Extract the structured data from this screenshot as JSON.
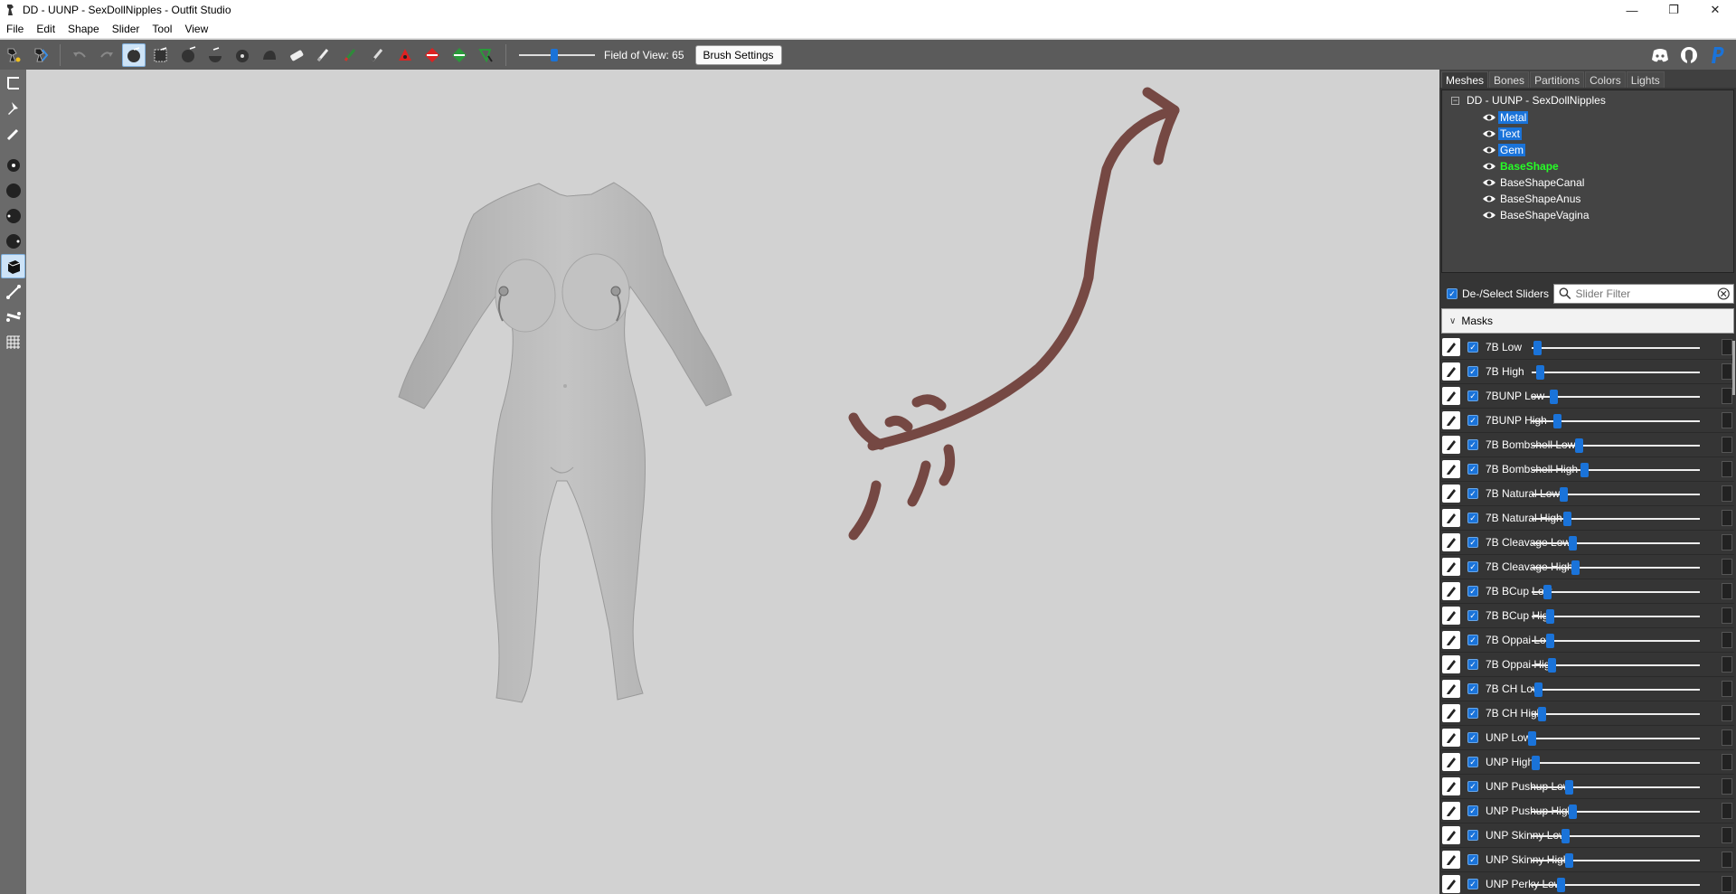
{
  "window": {
    "title": "DD - UUNP - SexDollNipples - Outfit Studio",
    "controls": [
      "minimize",
      "maximize",
      "close"
    ]
  },
  "menu": [
    "File",
    "Edit",
    "Shape",
    "Slider",
    "Tool",
    "View"
  ],
  "toolbar": {
    "field_of_view_label": "Field of View: 65",
    "fov_value": 65,
    "brush_settings_label": "Brush Settings",
    "icons": [
      "select-icon",
      "transform-icon",
      "undo-icon",
      "redo-icon",
      "standard-brush-icon",
      "mask-brush-icon",
      "inflate-brush-icon",
      "deflate-brush-icon",
      "move-brush-icon",
      "smooth-brush-icon",
      "undiff-brush-icon",
      "color-brush-icon",
      "alpha-brush-icon",
      "weight-brush-icon",
      "marker-icon",
      "collapse-icon",
      "flip-icon",
      "edit-vertex-icon"
    ],
    "right_icons": [
      "discord-icon",
      "github-icon",
      "paypal-icon"
    ]
  },
  "left_tools": [
    "transform-icon",
    "pivot-icon",
    "pen-icon",
    "brush-small-icon",
    "brush-medium-icon",
    "brush-large-icon",
    "brush-xlarge-icon",
    "select-box-icon",
    "bone-icon",
    "vertex-icon",
    "grid-icon"
  ],
  "tabs": [
    "Meshes",
    "Bones",
    "Partitions",
    "Colors",
    "Lights"
  ],
  "active_tab": "Meshes",
  "mesh_tree": {
    "root": "DD - UUNP - SexDollNipples",
    "items": [
      {
        "label": "Metal",
        "state": "selected"
      },
      {
        "label": "Text",
        "state": "selected"
      },
      {
        "label": "Gem",
        "state": "selected"
      },
      {
        "label": "BaseShape",
        "state": "reference"
      },
      {
        "label": "BaseShapeCanal",
        "state": "normal"
      },
      {
        "label": "BaseShapeAnus",
        "state": "normal"
      },
      {
        "label": "BaseShapeVagina",
        "state": "normal"
      }
    ]
  },
  "slider_panel": {
    "deselect_label": "De-/Select Sliders",
    "filter_placeholder": "Slider Filter",
    "group_label": "Masks",
    "sliders": [
      {
        "name": "7B Low",
        "value": 0.03
      },
      {
        "name": "7B High",
        "value": 0.05
      },
      {
        "name": "7BUNP Low",
        "value": 0.13
      },
      {
        "name": "7BUNP High",
        "value": 0.15
      },
      {
        "name": "7B Bombshell Low",
        "value": 0.28
      },
      {
        "name": "7B Bombshell High",
        "value": 0.31
      },
      {
        "name": "7B Natural Low",
        "value": 0.19
      },
      {
        "name": "7B Natural High",
        "value": 0.21
      },
      {
        "name": "7B Cleavage Low",
        "value": 0.24
      },
      {
        "name": "7B Cleavage High",
        "value": 0.26
      },
      {
        "name": "7B BCup Low",
        "value": 0.09
      },
      {
        "name": "7B BCup High",
        "value": 0.11
      },
      {
        "name": "7B Oppai Low",
        "value": 0.11
      },
      {
        "name": "7B Oppai High",
        "value": 0.12
      },
      {
        "name": "7B CH Low",
        "value": 0.04
      },
      {
        "name": "7B CH High",
        "value": 0.06
      },
      {
        "name": "UNP Low",
        "value": 0.0
      },
      {
        "name": "UNP High",
        "value": 0.02
      },
      {
        "name": "UNP Pushup Low",
        "value": 0.22
      },
      {
        "name": "UNP Pushup High",
        "value": 0.24
      },
      {
        "name": "UNP Skinny Low",
        "value": 0.2
      },
      {
        "name": "UNP Skinny High",
        "value": 0.22
      },
      {
        "name": "UNP Perky Low",
        "value": 0.17
      }
    ]
  },
  "colors": {
    "selection": "#1a73d9",
    "reference_mesh": "#26ff26",
    "annotation_arrow": "#6b3a34"
  }
}
